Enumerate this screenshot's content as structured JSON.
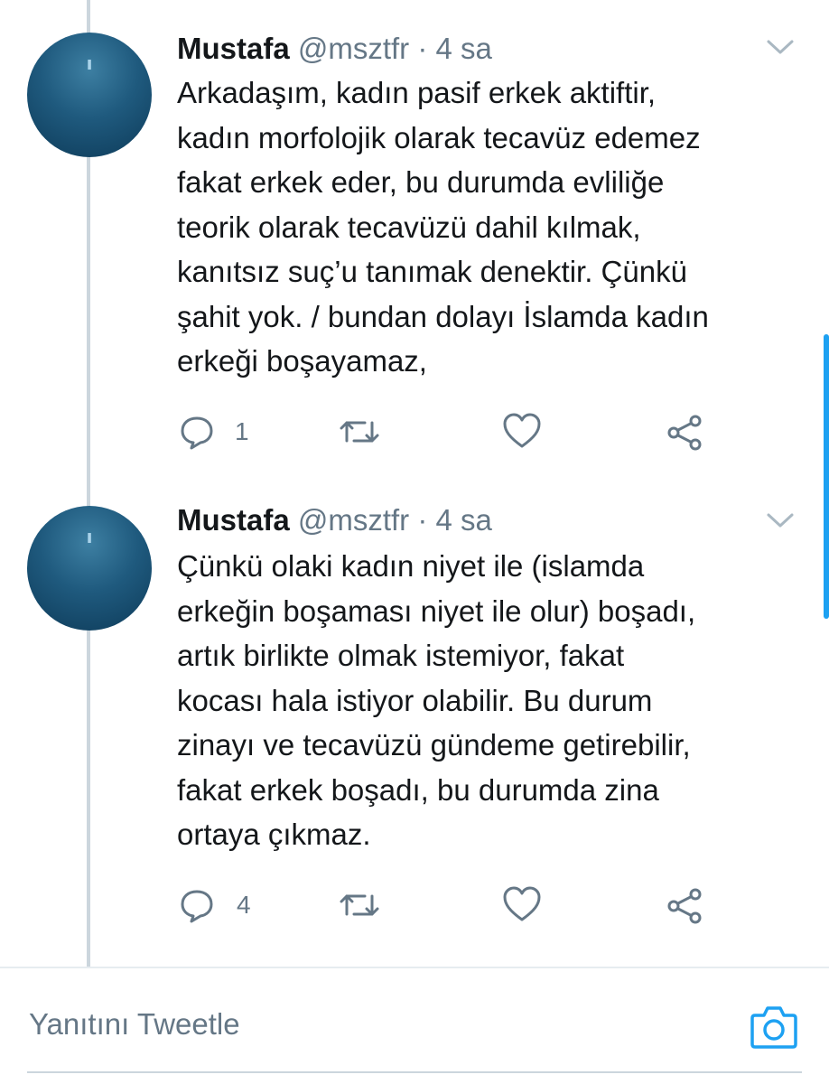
{
  "tweets": [
    {
      "name": "Mustafa",
      "handle": "@msztfr",
      "separator": "·",
      "time": "4 sa",
      "lines": [
        "Arkadaşım, kadın pasif erkek aktiftir,",
        "kadın morfolojik olarak tecavüz edemez",
        "fakat erkek eder, bu durumda evliliğe",
        "teorik olarak tecavüzü dahil kılmak,",
        "kanıtsız suç’u tanımak denektir. Çünkü",
        "şahit yok. / bundan dolayı İslamda kadın",
        "erkeği boşayamaz,"
      ],
      "reply_count": "1"
    },
    {
      "name": "Mustafa",
      "handle": "@msztfr",
      "separator": "·",
      "time": "4 sa",
      "lines": [
        "Çünkü olaki kadın niyet ile (islamda",
        "erkeğin boşaması niyet ile olur) boşadı,",
        "artık birlikte olmak istemiyor, fakat",
        "kocası hala istiyor olabilir. Bu durum",
        "zinayı ve tecavüzü gündeme getirebilir,",
        "fakat erkek boşadı, bu durumda zina",
        "ortaya çıkmaz."
      ],
      "reply_count": "4"
    }
  ],
  "composer": {
    "placeholder": "Yanıtını Tweetle"
  },
  "icons": {
    "reply": "reply-icon",
    "retweet": "retweet-icon",
    "like": "heart-icon",
    "share": "share-icon",
    "more": "chevron-down-icon",
    "camera": "camera-icon"
  },
  "colors": {
    "text": "#14171a",
    "secondary": "#657786",
    "accent": "#1da1f2",
    "thread_line": "#ccd6dd"
  }
}
